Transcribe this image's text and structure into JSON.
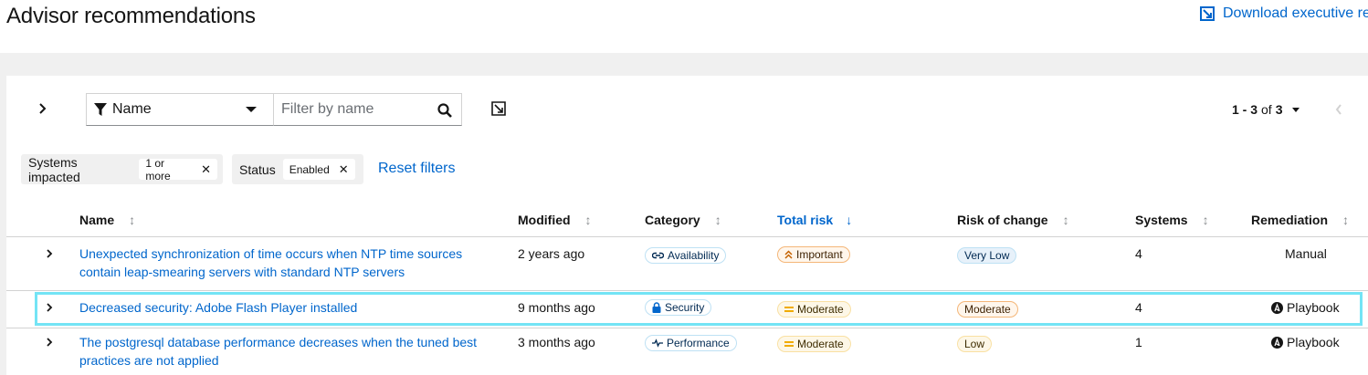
{
  "page": {
    "title": "Advisor recommendations",
    "download_label": "Download executive re"
  },
  "toolbar": {
    "filter_attribute": "Name",
    "search_placeholder": "Filter by name",
    "pagination_range": "1 - 3",
    "pagination_of": "of",
    "pagination_total": "3"
  },
  "filters": {
    "chips": [
      {
        "category": "Systems impacted",
        "value": "1 or more"
      },
      {
        "category": "Status",
        "value": "Enabled"
      }
    ],
    "reset_label": "Reset filters"
  },
  "table": {
    "columns": [
      "Name",
      "Modified",
      "Category",
      "Total risk",
      "Risk of change",
      "Systems",
      "Remediation"
    ],
    "sorted_column": "Total risk",
    "rows": [
      {
        "name_line1": "Unexpected synchronization of time occurs when NTP time sources",
        "name_line2": "contain leap-smearing servers with standard NTP servers",
        "modified": "2 years ago",
        "category": "Availability",
        "category_icon": "link-icon",
        "total_risk": "Important",
        "total_risk_icon": "double-chevron-up-icon",
        "risk_of_change": "Very Low",
        "systems": "4",
        "remediation": "Manual"
      },
      {
        "name_line1": "Decreased security: Adobe Flash Player installed",
        "name_line2": "",
        "modified": "9 months ago",
        "category": "Security",
        "category_icon": "lock-icon",
        "total_risk": "Moderate",
        "total_risk_icon": "equals-icon",
        "risk_of_change": "Moderate",
        "systems": "4",
        "remediation": "Playbook"
      },
      {
        "name_line1": "The postgresql database performance decreases when the tuned best",
        "name_line2": "practices are not applied",
        "modified": "3 months ago",
        "category": "Performance",
        "category_icon": "pulse-icon",
        "total_risk": "Moderate",
        "total_risk_icon": "equals-icon",
        "risk_of_change": "Low",
        "systems": "1",
        "remediation": "Playbook"
      }
    ]
  },
  "colors": {
    "link": "#0066cc",
    "highlight": "#73e4f5",
    "band": "#f0f0f0"
  }
}
